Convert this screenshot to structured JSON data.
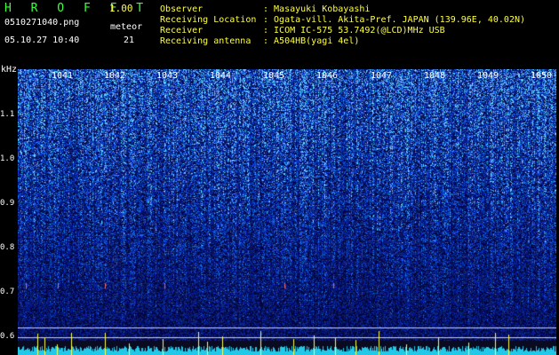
{
  "header": {
    "title": "H R O F F T",
    "version": "1.00",
    "file_name": "0510271040.png",
    "meteor_label": "meteor",
    "date_time": "05.10.27 10:40",
    "meteor_count": "21"
  },
  "info": [
    {
      "label": "Observer",
      "value": ": Masayuki Kobayashi"
    },
    {
      "label": "Receiving Location",
      "value": ": Ogata-vill. Akita-Pref. JAPAN (139.96E, 40.02N)"
    },
    {
      "label": "Receiver",
      "value": ": ICOM IC-575 53.7492(@LCD)MHz USB"
    },
    {
      "label": "Receiving antenna",
      "value": ": A504HB(yagi 4el)"
    }
  ],
  "axis": {
    "y_unit": "kHz",
    "y_ticks": [
      "1.1",
      "1.0",
      "0.9",
      "0.8",
      "0.7",
      "0.6"
    ],
    "x_ticks": [
      "1041",
      "1042",
      "1043",
      "1044",
      "1045",
      "1046",
      "1047",
      "1048",
      "1049",
      "1050"
    ]
  },
  "colors": {
    "title": "#3cff3c",
    "info": "#ffff40",
    "background": "#000000",
    "noise_low": "#0a1a6e",
    "noise_high": "#4a7dff",
    "baseline": "#22c8e8"
  }
}
